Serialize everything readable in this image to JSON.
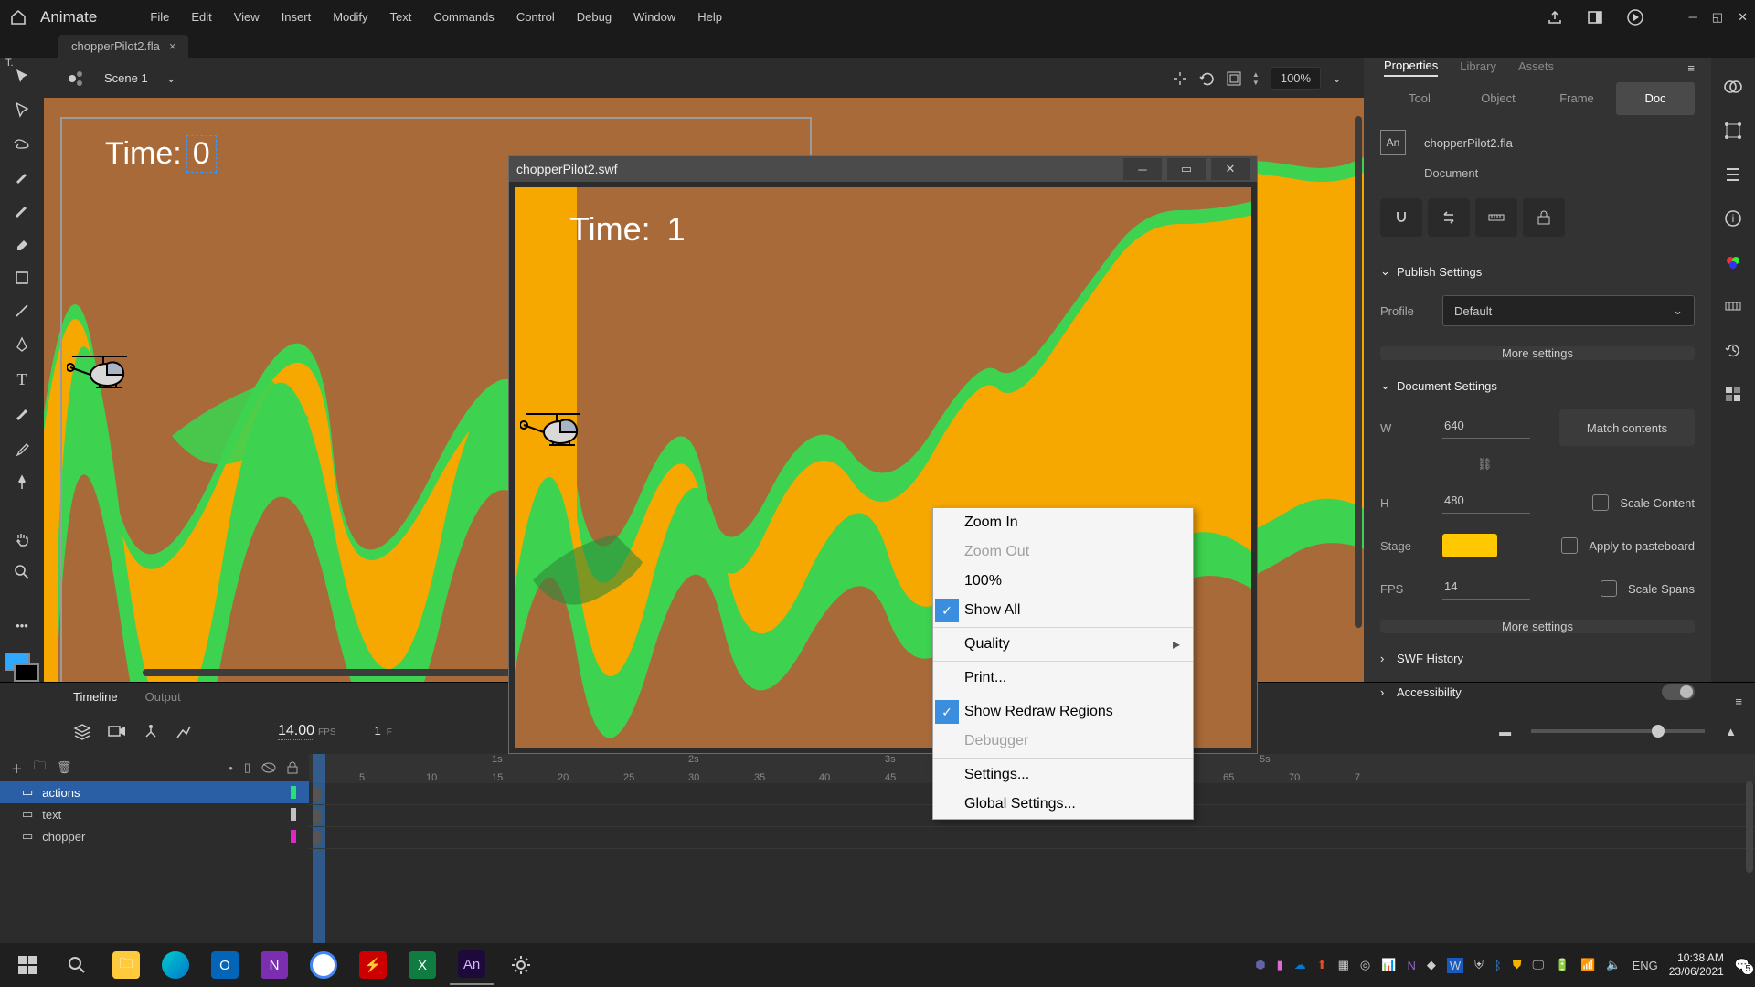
{
  "app": {
    "name": "Animate"
  },
  "menubar": [
    "File",
    "Edit",
    "View",
    "Insert",
    "Modify",
    "Text",
    "Commands",
    "Control",
    "Debug",
    "Window",
    "Help"
  ],
  "tab": {
    "filename": "chopperPilot2.fla"
  },
  "scenebar": {
    "scene": "Scene 1",
    "zoom": "100%"
  },
  "stage": {
    "time_label": "Time:",
    "time_value": "0"
  },
  "swf": {
    "title": "chopperPilot2.swf",
    "time_label": "Time:",
    "time_value": "1"
  },
  "contextmenu": {
    "zoom_in": "Zoom In",
    "zoom_out": "Zoom Out",
    "pct_100": "100%",
    "show_all": "Show All",
    "quality": "Quality",
    "print": "Print...",
    "show_redraw": "Show Redraw Regions",
    "debugger": "Debugger",
    "settings": "Settings...",
    "global_settings": "Global Settings..."
  },
  "properties": {
    "tabs": {
      "properties": "Properties",
      "library": "Library",
      "assets": "Assets"
    },
    "modes": {
      "tool": "Tool",
      "object": "Object",
      "frame": "Frame",
      "doc": "Doc"
    },
    "docicon": "An",
    "docname": "chopperPilot2.fla",
    "doclabel": "Document",
    "publish_hdr": "Publish Settings",
    "profile_label": "Profile",
    "profile_value": "Default",
    "more_settings": "More settings",
    "docset_hdr": "Document Settings",
    "w_label": "W",
    "w_value": "640",
    "h_label": "H",
    "h_value": "480",
    "match": "Match contents",
    "scale_content": "Scale Content",
    "stage_label": "Stage",
    "apply_paste": "Apply to pasteboard",
    "fps_label": "FPS",
    "fps_value": "14",
    "scale_spans": "Scale Spans",
    "swf_history": "SWF History",
    "accessibility": "Accessibility"
  },
  "timeline": {
    "tabs": {
      "timeline": "Timeline",
      "output": "Output"
    },
    "fps_num": "14.00",
    "fps_lbl": "FPS",
    "frame_num": "1",
    "frame_lbl": "F",
    "seconds": [
      "1s",
      "2s",
      "3s",
      "5s"
    ],
    "ticks": [
      "5",
      "10",
      "15",
      "20",
      "25",
      "30",
      "35",
      "40",
      "45",
      "65",
      "70",
      "7"
    ],
    "layers": [
      {
        "name": "actions",
        "color": "#24e276",
        "selected": true
      },
      {
        "name": "text",
        "color": "#c0c0c0",
        "selected": false
      },
      {
        "name": "chopper",
        "color": "#e225c5",
        "selected": false
      }
    ]
  },
  "taskbar": {
    "lang": "ENG",
    "time": "10:38 AM",
    "date": "23/06/2021",
    "notif_count": "5"
  }
}
